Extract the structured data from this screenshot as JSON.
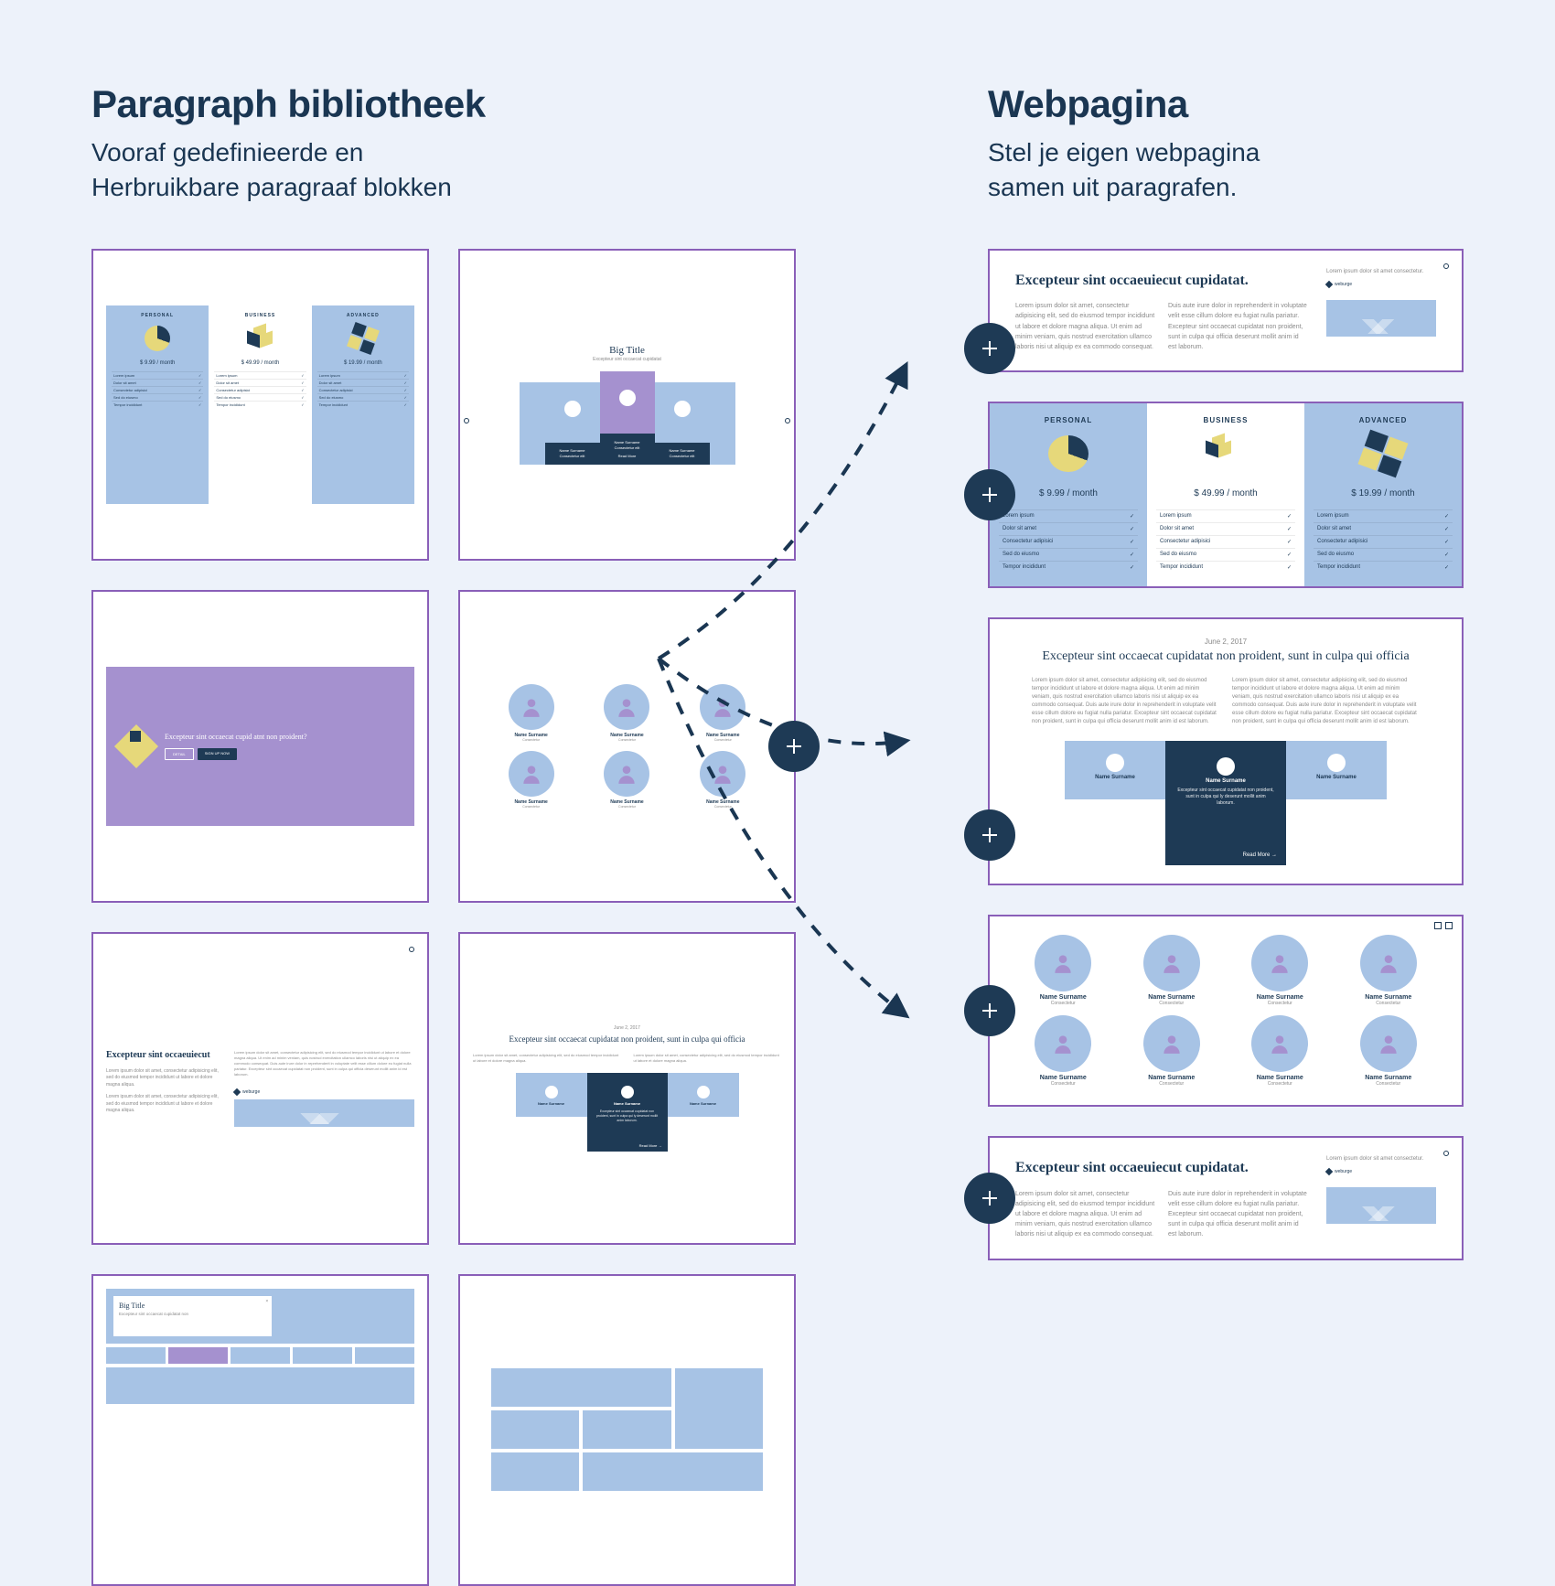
{
  "library": {
    "title": "Paragraph bibliotheek",
    "subtitle_line1": "Vooraf gedefinieerde en",
    "subtitle_line2": "Herbruikbare paragraaf blokken"
  },
  "webpage": {
    "title": "Webpagina",
    "subtitle_line1": "Stel je eigen webpagina",
    "subtitle_line2": "samen uit paragrafen."
  },
  "pricing": {
    "tiers": [
      {
        "label": "PERSONAL",
        "price": "$ 9.99 / month"
      },
      {
        "label": "BUSINESS",
        "price": "$ 49.99 / month"
      },
      {
        "label": "ADVANCED",
        "price": "$ 19.99 / month"
      }
    ],
    "features": [
      "Lorem ipsum",
      "Dolor sit amet",
      "Consectetur adipisici",
      "Sed do eiusmo",
      "Tempor incididunt"
    ],
    "check": "✓"
  },
  "carousel": {
    "big_title": "Big Title",
    "subtitle": "Excepteur sint occaecat cupidatat",
    "name": "Name Surname",
    "meta": "Consectetur elit",
    "read_more": "Read More"
  },
  "cta": {
    "question": "Excepteur sint occaecat cupid atnt non proident?",
    "btn_outline": "DETAIL",
    "btn_solid": "SIGN UP NOW"
  },
  "team": {
    "name": "Name Surname",
    "role": "Consectetur"
  },
  "article": {
    "heading": "Excepteur sint occaeuiecut",
    "heading2": "Excepteur sint occaeuiecut cupidatat.",
    "lorem_short": "Lorem ipsum dolor sit amet, consectetur adipisicing elit, sed do eiusmod tempor incididunt ut labore et dolore magna aliqua.",
    "lorem_long": "Lorem ipsum dolor sit amet, consectetur adipisicing elit, sed do eiusmod tempor incididunt ut labore et dolore magna aliqua. Ut enim ad minim veniam, quis nostrud exercitation ullamco laboris nisi ut aliquip ex ea commodo consequat. Duis aute irure dolor in reprehenderit in voluptate velit esse cillum dolore eu fugiat nulla pariatur. Excepteur sint occaecat cupidatat non proident, sunt in culpa qui officia deserunt mollit anim id est laborum.",
    "lorem_small": "Lorem ipsum dolor sit amet consectetur.",
    "weblogo": "weburge"
  },
  "testimonial": {
    "date": "June 2, 2017",
    "title": "Excepteur sint occaecat cupidatat non proident, sunt in culpa qui officia",
    "name": "Name Surname",
    "quote": "Excepteur sint occaecat cupidatat non proident, sunt in culpa qui ly deserunt mollit anim laborum.",
    "read_more": "Read More  →"
  },
  "tabs": {
    "big_title": "Big Title",
    "subtitle": "Excepteur sint occaecat cupidatat non"
  }
}
